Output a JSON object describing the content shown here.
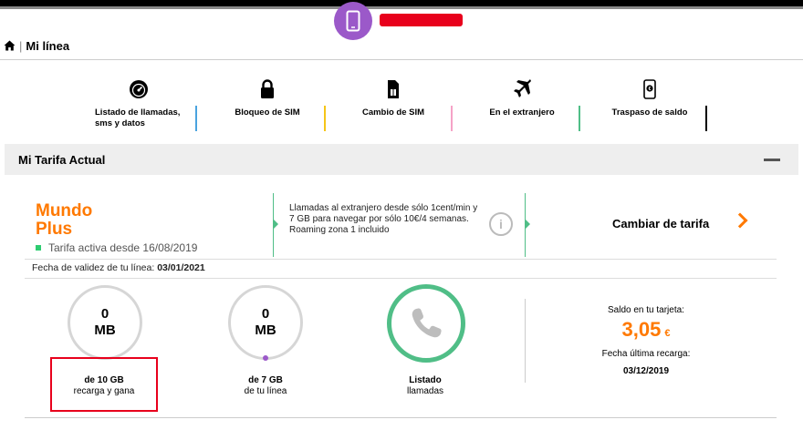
{
  "breadcrumb": {
    "separator": "|",
    "title": "Mi línea"
  },
  "quick_actions": [
    {
      "label": "Listado de llamadas, sms y datos",
      "icon": "gauge-icon",
      "bar_color": "#4aa3df"
    },
    {
      "label": "Bloqueo de SIM",
      "icon": "lock-icon",
      "bar_color": "#f5c518"
    },
    {
      "label": "Cambio de SIM",
      "icon": "sim-card-icon",
      "bar_color": "#f5a3c7"
    },
    {
      "label": "En el extranjero",
      "icon": "airplane-icon",
      "bar_color": "#50be87"
    },
    {
      "label": "Traspaso de saldo",
      "icon": "mobile-euro-icon",
      "bar_color": "#000000"
    }
  ],
  "tarifa": {
    "section_title": "Mi Tarifa Actual",
    "plan_name_1": "Mundo",
    "plan_name_2": "Plus",
    "active_text": "Tarifa activa desde 16/08/2019",
    "promo_text": "Llamadas al extranjero desde sólo 1cent/min y 7 GB para navegar por sólo 10€/4 semanas. Roaming zona 1 incluido",
    "info_glyph": "i",
    "change_label": "Cambiar de tarifa",
    "validity_label": "Fecha de validez de tu línea:",
    "validity_date": "03/01/2021"
  },
  "usage": [
    {
      "value": "0",
      "unit": "MB",
      "caption_bold": "de 10 GB",
      "caption": "recarga y gana"
    },
    {
      "value": "0",
      "unit": "MB",
      "caption_bold": "de 7 GB",
      "caption": "de tu línea"
    }
  ],
  "calls": {
    "caption_bold": "Listado",
    "caption": "llamadas"
  },
  "saldo": {
    "label": "Saldo en tu tarjeta:",
    "amount": "3,05",
    "currency": "€",
    "last_label": "Fecha última recarga:",
    "last_date": "03/12/2019"
  },
  "colors": {
    "brand": "#ff7900",
    "accent_green": "#50be87",
    "badge_purple": "#9b59c9",
    "highlight_red": "#e8001c"
  }
}
